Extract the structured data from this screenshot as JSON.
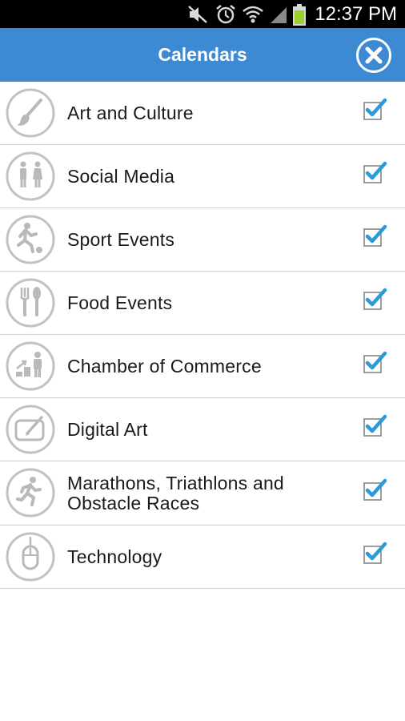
{
  "status_bar": {
    "time": "12:37 PM"
  },
  "header": {
    "title": "Calendars"
  },
  "calendars": [
    {
      "label": "Art and Culture",
      "icon": "paintbrush-icon",
      "checked": true
    },
    {
      "label": "Social Media",
      "icon": "people-icon",
      "checked": true
    },
    {
      "label": "Sport Events",
      "icon": "soccer-player-icon",
      "checked": true
    },
    {
      "label": "Food Events",
      "icon": "fork-spoon-icon",
      "checked": true
    },
    {
      "label": "Chamber of Commerce",
      "icon": "business-growth-icon",
      "checked": true
    },
    {
      "label": "Digital Art",
      "icon": "drawing-tablet-icon",
      "checked": true
    },
    {
      "label": "Marathons, Triathlons and Obstacle Races",
      "icon": "runner-icon",
      "checked": true
    },
    {
      "label": "Technology",
      "icon": "computer-mouse-icon",
      "checked": true
    }
  ],
  "colors": {
    "header": "#3d89d2",
    "check": "#2a9ad8",
    "icon_gray": "#b9b9b9"
  }
}
